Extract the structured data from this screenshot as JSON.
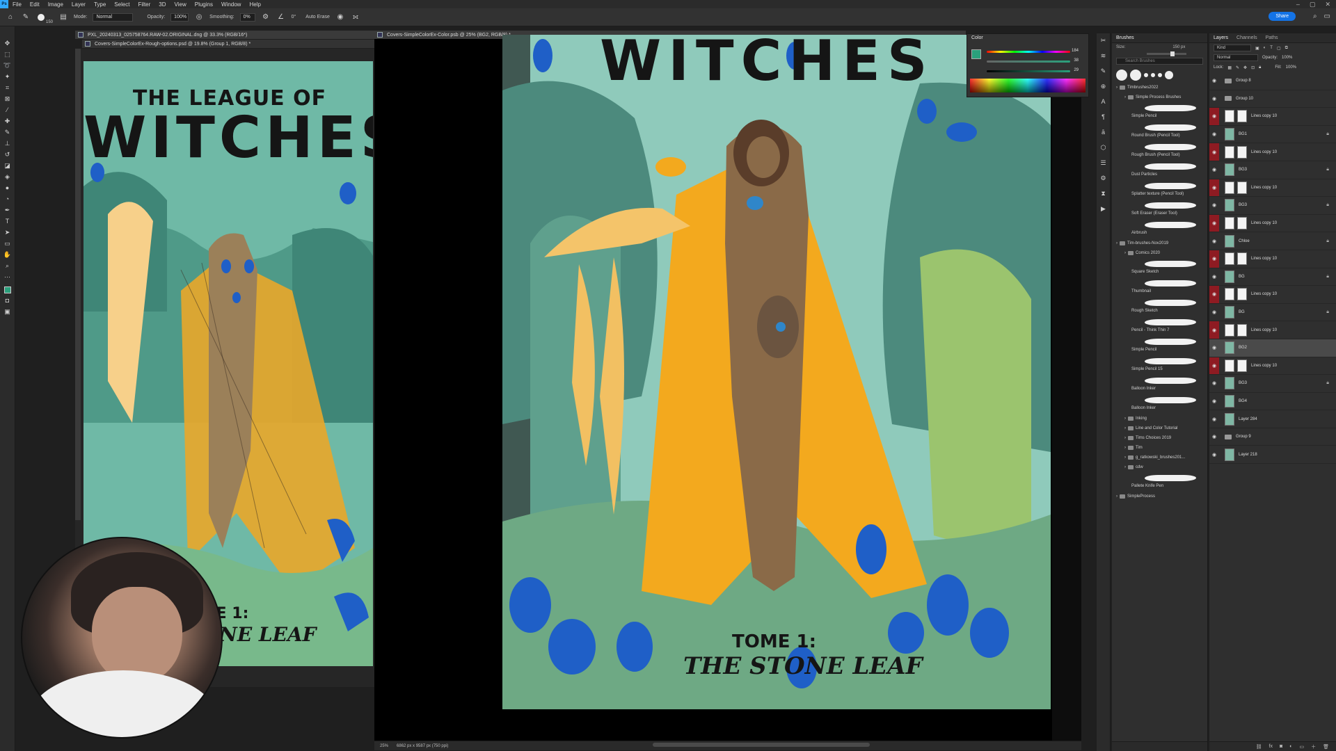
{
  "menubar": {
    "logo": "Ps",
    "items": [
      "File",
      "Edit",
      "Image",
      "Layer",
      "Type",
      "Select",
      "Filter",
      "3D",
      "View",
      "Plugins",
      "Window",
      "Help"
    ]
  },
  "options": {
    "mode_label": "Mode:",
    "mode_value": "Normal",
    "opacity_label": "Opacity:",
    "opacity_value": "100%",
    "smoothing_label": "Smoothing:",
    "smoothing_value": "0%",
    "angle_value": "0°",
    "auto_erase": "Auto Erase",
    "brush_size": "150",
    "share": "Share"
  },
  "docs": {
    "left_tab1": "PXL_20240313_025758764.RAW-02.ORIGINAL.dng @ 33.3% (RGB/16*)",
    "left_tab2": "Covers-SimpleColorEx-Rough-options.psd @ 19.8% (Group 1, RGB/8) *",
    "right_tab": "Covers-SimpleColorEx-Color.psb @ 25% (BG2, RGB/8) *"
  },
  "artwork": {
    "title_top": "THE LEAGUE OF",
    "title_main": "WITCHES",
    "tome": "TOME 1:",
    "subtitle": "THE STONE LEAF",
    "subtitle_partial": "TONE LEAF",
    "tome_partial": "OME 1:",
    "title_partial": "WITCHES"
  },
  "status": {
    "zoom": "25%",
    "dims": "6862 px x 9587 px (750 ppi)"
  },
  "color_panel": {
    "title": "Color",
    "h": "184",
    "s": "38",
    "b": "29"
  },
  "brushes": {
    "tabs": [
      "Brushes"
    ],
    "size_label": "Size:",
    "size_value": "150 px",
    "search_placeholder": "Search Brushes",
    "items": [
      {
        "type": "folder",
        "label": "Timbrushes2022"
      },
      {
        "type": "folder",
        "label": "Simple Process Brushes"
      },
      {
        "type": "brush",
        "label": "Simple Pencil"
      },
      {
        "type": "brush",
        "label": "Round Brush (Pencil Tool)"
      },
      {
        "type": "brush",
        "label": "Rough Brush (Pencil Tool)"
      },
      {
        "type": "brush",
        "label": "Dust Particles"
      },
      {
        "type": "brush",
        "label": "Splatter texture (Pencil Tool)"
      },
      {
        "type": "brush",
        "label": "Soft Eraser (Eraser Tool)"
      },
      {
        "type": "brush",
        "label": "Airbrush"
      },
      {
        "type": "folder",
        "label": "Tim-brushes-Nov2019"
      },
      {
        "type": "folder",
        "label": "Comics 2020"
      },
      {
        "type": "brush",
        "label": "Square Sketch"
      },
      {
        "type": "brush",
        "label": "Thumbnail"
      },
      {
        "type": "brush",
        "label": "Rough Sketch"
      },
      {
        "type": "brush",
        "label": "Pencil - Think Thin 7"
      },
      {
        "type": "brush",
        "label": "Simple Pencil"
      },
      {
        "type": "brush",
        "label": "Simple Pencil 15"
      },
      {
        "type": "brush",
        "label": "Balloon Inker"
      },
      {
        "type": "brush",
        "label": "Balloon Inker"
      },
      {
        "type": "folder",
        "label": "Inking"
      },
      {
        "type": "folder",
        "label": "Line and Color Tutorial"
      },
      {
        "type": "folder",
        "label": "Tims Choices 2019"
      },
      {
        "type": "folder",
        "label": "Tim"
      },
      {
        "type": "folder",
        "label": "g_ratkowski_brushes201..."
      },
      {
        "type": "folder",
        "label": "cdw"
      },
      {
        "type": "brush",
        "label": "Pallete Knife Pen"
      },
      {
        "type": "folder",
        "label": "SimpleProcess"
      }
    ]
  },
  "layers": {
    "tabs": [
      "Layers",
      "Channels",
      "Paths"
    ],
    "kind_label": "Kind",
    "blend_mode": "Normal",
    "opacity_label": "Opacity:",
    "opacity_value": "100%",
    "lock_label": "Lock:",
    "fill_label": "Fill:",
    "fill_value": "100%",
    "rows": [
      {
        "name": "Group 8",
        "kind": "folder",
        "red": false,
        "locked": false
      },
      {
        "name": "Group 10",
        "kind": "folder",
        "red": false,
        "locked": false
      },
      {
        "name": "Lines copy 10",
        "kind": "layer",
        "red": true,
        "locked": false
      },
      {
        "name": "BG1",
        "kind": "layer",
        "red": false,
        "locked": true
      },
      {
        "name": "Lines copy 10",
        "kind": "layer",
        "red": true,
        "locked": false
      },
      {
        "name": "BG3",
        "kind": "layer",
        "red": false,
        "locked": true
      },
      {
        "name": "Lines copy 10",
        "kind": "layer",
        "red": true,
        "locked": false
      },
      {
        "name": "BG3",
        "kind": "layer",
        "red": false,
        "locked": true
      },
      {
        "name": "Lines copy 10",
        "kind": "layer",
        "red": true,
        "locked": false
      },
      {
        "name": "Chloe",
        "kind": "layer",
        "red": false,
        "locked": true
      },
      {
        "name": "Lines copy 10",
        "kind": "layer",
        "red": true,
        "locked": false
      },
      {
        "name": "BG",
        "kind": "layer",
        "red": false,
        "locked": true
      },
      {
        "name": "Lines copy 10",
        "kind": "layer",
        "red": true,
        "locked": false
      },
      {
        "name": "BG",
        "kind": "layer",
        "red": false,
        "locked": true
      },
      {
        "name": "Lines copy 10",
        "kind": "layer",
        "red": true,
        "locked": false
      },
      {
        "name": "BG2",
        "kind": "layer",
        "red": false,
        "locked": false,
        "selected": true
      },
      {
        "name": "Lines copy 10",
        "kind": "layer",
        "red": true,
        "locked": false
      },
      {
        "name": "BG3",
        "kind": "layer",
        "red": false,
        "locked": true
      },
      {
        "name": "BG4",
        "kind": "layer",
        "red": false,
        "locked": false
      },
      {
        "name": "Layer 284",
        "kind": "layer",
        "red": false,
        "locked": false
      },
      {
        "name": "Group 9",
        "kind": "folder",
        "red": false,
        "locked": false
      },
      {
        "name": "Layer 218",
        "kind": "layer",
        "red": false,
        "locked": false
      }
    ]
  },
  "colors": {
    "accent": "#1473e6",
    "layer_red": "#8e1b22",
    "art_teal": "#83c9b4",
    "cape_yellow": "#f3a91e",
    "flower_blue": "#1f5fc7"
  }
}
